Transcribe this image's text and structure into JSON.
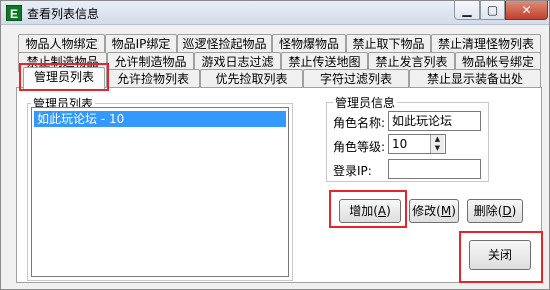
{
  "window": {
    "title": "查看列表信息",
    "app_icon": "E"
  },
  "title_buttons": {
    "minimize": "▁",
    "maximize": "▢",
    "close": "✕"
  },
  "tabs_row1": [
    "物品人物绑定",
    "物品IP绑定",
    "巡逻怪捡起物品",
    "怪物爆物品",
    "禁止取下物品",
    "禁止清理怪物列表"
  ],
  "tabs_row2": [
    "禁止制造物品",
    "允许制造物品",
    "游戏日志过滤",
    "禁止传送地图",
    "禁止发言列表",
    "物品帐号绑定"
  ],
  "tabs_row3": [
    "管理员列表",
    "允许捡物列表",
    "优先捡取列表",
    "字符过滤列表",
    "禁止显示装备出处"
  ],
  "admin_list": {
    "label": "管理员列表",
    "items": [
      "如此玩论坛 - 10"
    ]
  },
  "admin_info": {
    "label": "管理员信息",
    "name_label": "角色名称:",
    "name_value": "如此玩论坛",
    "level_label": "角色等级:",
    "level_value": "10",
    "ip_label": "登录IP:",
    "ip_value": ""
  },
  "buttons": {
    "add": "增加",
    "add_key": "A",
    "modify": "修改",
    "modify_key": "M",
    "delete": "删除",
    "delete_key": "D",
    "close": "关闭"
  }
}
